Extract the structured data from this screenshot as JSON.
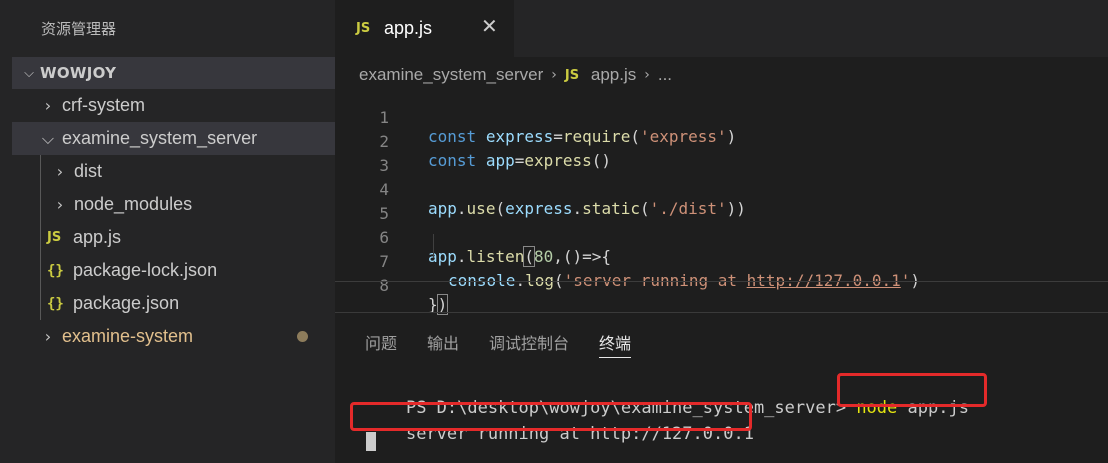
{
  "sidebar": {
    "title": "资源管理器",
    "folder": "WOWJOY",
    "items": [
      {
        "label": "crf-system",
        "type": "folder"
      },
      {
        "label": "examine_system_server",
        "type": "folder-open"
      },
      {
        "label": "dist",
        "type": "folder"
      },
      {
        "label": "node_modules",
        "type": "folder"
      },
      {
        "label": "app.js",
        "type": "js"
      },
      {
        "label": "package-lock.json",
        "type": "json"
      },
      {
        "label": "package.json",
        "type": "json"
      },
      {
        "label": "examine-system",
        "type": "folder"
      }
    ],
    "js_badge": "JS",
    "json_badge": "{}"
  },
  "editor": {
    "tab_label": "app.js",
    "tab_close": "✕",
    "breadcrumb": {
      "folder": "examine_system_server",
      "file": "app.js",
      "more": "..."
    },
    "line_numbers": [
      "1",
      "2",
      "3",
      "4",
      "5",
      "6",
      "7",
      "8"
    ],
    "code": {
      "l1_kw": "const",
      "l1_var": "express",
      "l1_eq": "=",
      "l1_fn": "require",
      "l1_str": "'express'",
      "l2_kw": "const",
      "l2_var": "app",
      "l2_eq": "=",
      "l2_fn": "express",
      "l4_var": "app",
      "l4_fn": "use",
      "l4_var2": "express",
      "l4_fn2": "static",
      "l4_str": "'./dist'",
      "l6_var": "app",
      "l6_fn": "listen",
      "l6_num": "80",
      "l7_var": "console",
      "l7_fn": "log",
      "l7_str_a": "'server running at ",
      "l7_url": "http://127.0.0.1",
      "l7_str_b": "'"
    }
  },
  "panel": {
    "tabs": [
      "问题",
      "输出",
      "调试控制台",
      "终端"
    ],
    "active_tab": "终端"
  },
  "terminal": {
    "prompt": "PS D:\\desktop\\wowjoy\\examine_system_server>",
    "command": "node",
    "command_arg": "app.js",
    "output": "server running at http://127.0.0.1"
  },
  "colors": {
    "highlight_box": "#e42a2a",
    "modified_folder": "#e2c08d",
    "js_icon": "#cbcb41"
  },
  "icons": {
    "chevron_right": "chevron-right-icon",
    "chevron_down": "chevron-down-icon",
    "js": "js-file-icon",
    "json": "json-file-icon",
    "close": "close-icon"
  }
}
